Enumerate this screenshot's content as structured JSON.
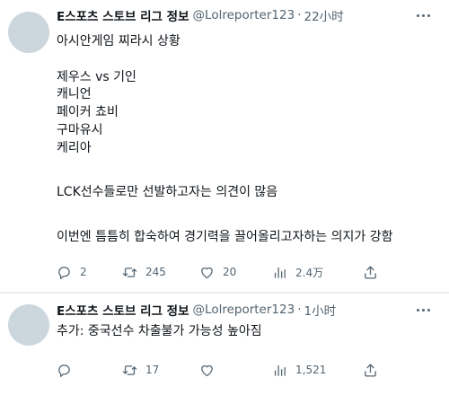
{
  "tweets": [
    {
      "author_name": "E스포츠 스토브 리그 정보",
      "handle": "@Lolreporter123",
      "separator": "·",
      "time": "22小时",
      "lines": [
        "아시안게임 찌라시 상황",
        "제우스 vs 기인",
        "캐니언",
        "페이커 쵸비",
        "구마유시",
        "케리아",
        "LCK선수들로만 선발하고자는 의견이 많음",
        "이번엔 틈틈히 합숙하여 경기력을 끌어올리고자하는 의지가 강함"
      ],
      "actions": {
        "replies": "2",
        "retweets": "245",
        "likes": "20",
        "views": "2.4万"
      }
    },
    {
      "author_name": "E스포츠 스토브 리그 정보",
      "handle": "@Lolreporter123",
      "separator": "·",
      "time": "1小时",
      "lines": [
        "추가: 중국선수 차출불가 가능성 높아짐"
      ],
      "actions": {
        "replies": "",
        "retweets": "17",
        "likes": "",
        "views": "1,521"
      }
    }
  ],
  "icons": {
    "reply": "reply-icon",
    "retweet": "retweet-icon",
    "like": "heart-icon",
    "views": "views-bar-chart-icon",
    "share": "share-icon",
    "more": "more-dots-icon"
  },
  "colors": {
    "text": "#0f1419",
    "secondary": "#536471",
    "avatar": "#ccd6dd",
    "divider": "#e8ecef"
  }
}
